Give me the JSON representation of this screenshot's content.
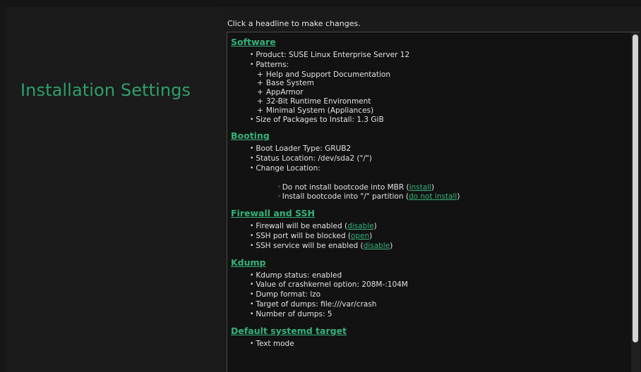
{
  "page_title": "Installation Settings",
  "hint": "Click a headline to make changes.",
  "sections": {
    "software": {
      "title": "Software",
      "product": "Product: SUSE Linux Enterprise Server 12",
      "patterns_label": "Patterns:",
      "patterns": [
        "Help and Support Documentation",
        "Base System",
        "AppArmor",
        "32-Bit Runtime Environment",
        "Minimal System (Appliances)"
      ],
      "size": "Size of Packages to Install: 1.3 GiB"
    },
    "booting": {
      "title": "Booting",
      "loader": "Boot Loader Type: GRUB2",
      "status": "Status Location: /dev/sda2 (\"/\")",
      "change": "Change Location:",
      "mbr_text": "Do not install bootcode into MBR (",
      "mbr_link": "install",
      "partition_text": "Install bootcode into \"/\" partition (",
      "partition_link": "do not install",
      "close_paren": ")"
    },
    "firewall": {
      "title": "Firewall and SSH",
      "firewall_text": "Firewall will be enabled (",
      "firewall_link": "disable",
      "ssh_port_text": "SSH port will be blocked (",
      "ssh_port_link": "open",
      "ssh_service_text": "SSH service will be enabled (",
      "ssh_service_link": "disable",
      "close_paren": ")"
    },
    "kdump": {
      "title": "Kdump",
      "items": [
        "Kdump status: enabled",
        "Value of crashkernel option: 208M-:104M",
        "Dump format: lzo",
        "Target of dumps: file:///var/crash",
        "Number of dumps: 5"
      ]
    },
    "systemd": {
      "title": "Default systemd target",
      "items": [
        "Text mode"
      ]
    }
  },
  "glyphs": {
    "bullet": "•",
    "plus": "+",
    "circle": "◦"
  },
  "colors": {
    "accent": "#35b27a",
    "title": "#2f9e6b",
    "background": "#161616",
    "text": "#e2e2e2"
  }
}
